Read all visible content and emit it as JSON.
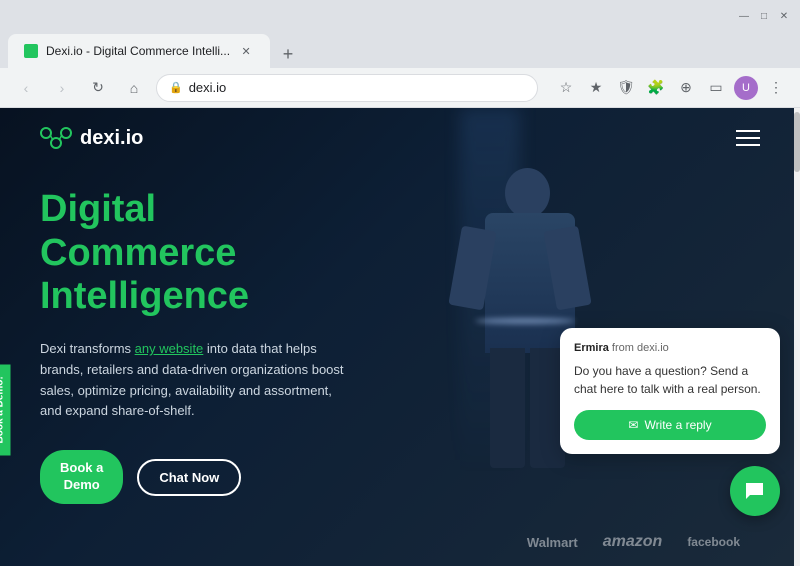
{
  "browser": {
    "tab_title": "Dexi.io - Digital Commerce Intelli...",
    "url": "dexi.io",
    "new_tab_icon": "+",
    "nav_back": "‹",
    "nav_forward": "›",
    "nav_refresh": "↻",
    "nav_home": "⌂",
    "window_controls": {
      "minimize": "—",
      "maximize": "□",
      "close": "✕"
    }
  },
  "website": {
    "logo_text": "dexi.io",
    "hero": {
      "title_line1": "Digital",
      "title_line2": "Commerce",
      "title_line3": "Intelligence",
      "description_plain": "Dexi transforms ",
      "description_highlight": "any website",
      "description_rest": " into data that helps brands, retailers and data-driven organizations boost sales, optimize pricing, availability and assortment, and expand share-of-shelf.",
      "cta_primary_line1": "Book a",
      "cta_primary_line2": "Demo",
      "cta_secondary": "Chat Now"
    },
    "book_demo_banner": "Book a Demo!",
    "bottom_logos": [
      "Walmart",
      "amazon",
      "facebook"
    ],
    "chat": {
      "agent_label": "from",
      "agent_name": "Ermira",
      "agent_source": "dexi.io",
      "message": "Do you have a question? Send a chat here to talk with a real person.",
      "reply_btn": "Write a reply",
      "reply_icon": "✉"
    },
    "chat_tab_label": "Chat"
  }
}
